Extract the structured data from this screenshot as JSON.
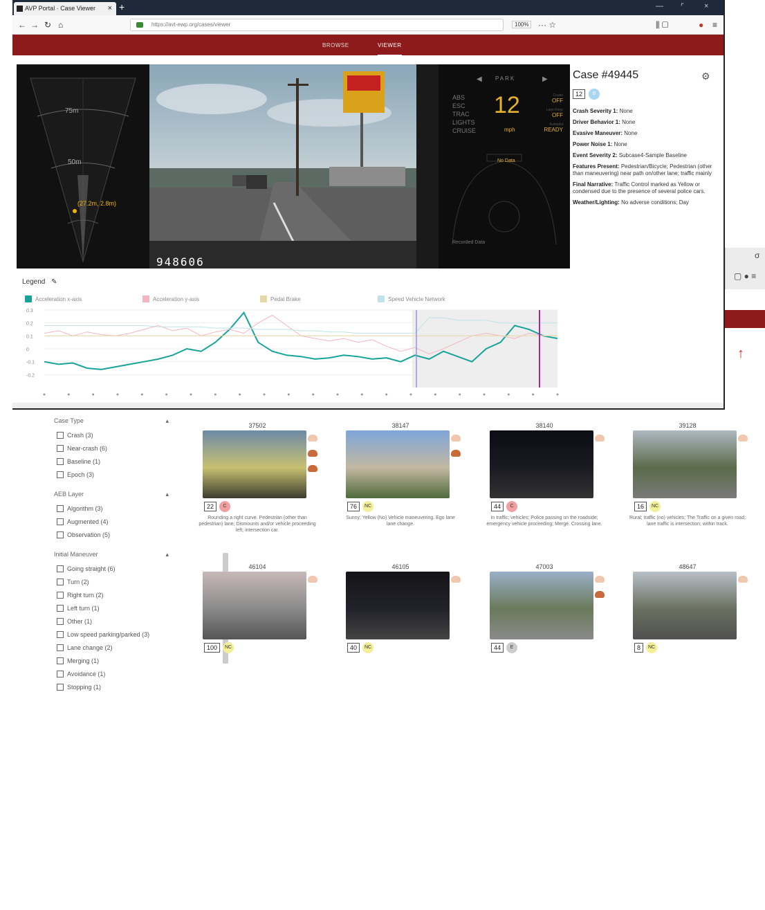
{
  "browser": {
    "tab_title": "AVP Portal · Case Viewer",
    "url": "https://avt-ewp.org/cases/viewer",
    "zoom": "100%",
    "menu_items": [
      "BROWSE",
      "VIEWER"
    ]
  },
  "dash": {
    "gear": "PARK",
    "speed": "12",
    "unit": "mph",
    "systems": [
      "ABS",
      "ESC",
      "TRAC",
      "LIGHTS",
      "CRUISE"
    ],
    "status_labels": [
      "Cruise",
      "Lane Keep",
      "Autopilot"
    ],
    "status_values": [
      "OFF",
      "OFF",
      "READY"
    ],
    "center_label": "No Data",
    "bottom_label": "Recorded Data",
    "frame_counter": "948606"
  },
  "radar": {
    "ranges": [
      "75m",
      "50m"
    ],
    "point_label": "(27.2m, 2.8m)"
  },
  "case": {
    "title": "Case #49445",
    "score": "12",
    "badge": "B",
    "lines": [
      {
        "key": "Crash Severity 1:",
        "val": "None"
      },
      {
        "key": "Driver Behavior 1:",
        "val": "None"
      },
      {
        "key": "Evasive Maneuver:",
        "val": "None"
      },
      {
        "key": "Power Noise 1:",
        "val": "None"
      },
      {
        "key": "Event Severity 2:",
        "val": "Subcase4-Sample Baseline"
      },
      {
        "key": "Features Present:",
        "val": "Pedestrian/Bicycle; Pedestrian (other than maneuvering) near path on/other lane; traffic mainly"
      },
      {
        "key": "Final Narrative:",
        "val": "Traffic Control marked as Yellow or condensed due to the presence of several police cars."
      },
      {
        "key": "Weather/Lighting:",
        "val": "No adverse conditions; Day"
      }
    ]
  },
  "chart_data": {
    "type": "line",
    "title": "",
    "legend_label": "Legend",
    "series": [
      {
        "name": "Acceleration x-axis",
        "color": "#17a398",
        "values": [
          -0.1,
          -0.12,
          -0.11,
          -0.15,
          -0.16,
          -0.14,
          -0.12,
          -0.1,
          -0.08,
          -0.05,
          0.0,
          -0.02,
          0.05,
          0.15,
          0.28,
          0.05,
          -0.02,
          -0.05,
          -0.06,
          -0.08,
          -0.07,
          -0.05,
          -0.06,
          -0.08,
          -0.07,
          -0.1,
          -0.05,
          -0.08,
          -0.02,
          -0.06,
          -0.1,
          0.0,
          0.05,
          0.18,
          0.15,
          0.1,
          0.08
        ]
      },
      {
        "name": "Acceleration y-axis",
        "color": "#f1b6bf",
        "values": [
          0.12,
          0.14,
          0.1,
          0.13,
          0.11,
          0.1,
          0.12,
          0.15,
          0.18,
          0.14,
          0.16,
          0.1,
          0.13,
          0.15,
          0.12,
          0.2,
          0.26,
          0.18,
          0.1,
          0.08,
          0.06,
          0.08,
          0.05,
          0.07,
          0.02,
          -0.02,
          0.01,
          -0.04,
          0.0,
          0.05,
          0.1,
          0.12,
          0.1,
          0.08,
          0.12,
          0.1,
          0.1
        ]
      },
      {
        "name": "Pedal Brake",
        "color": "#e8d8a8",
        "values": [
          0.1,
          0.1,
          0.1,
          0.1,
          0.1,
          0.1,
          0.1,
          0.1,
          0.1,
          0.1,
          0.1,
          0.1,
          0.1,
          0.1,
          0.1,
          0.1,
          0.1,
          0.1,
          0.1,
          0.1,
          0.1,
          0.1,
          0.1,
          0.1,
          0.1,
          0.1,
          0.1,
          0.1,
          0.1,
          0.1,
          0.1,
          0.1,
          0.1,
          0.1,
          0.1,
          0.1,
          0.1
        ]
      },
      {
        "name": "Speed Vehicle Network",
        "color": "#bfe3e8",
        "values": [
          0.18,
          0.18,
          0.18,
          0.18,
          0.18,
          0.18,
          0.18,
          0.18,
          0.17,
          0.17,
          0.17,
          0.17,
          0.16,
          0.16,
          0.16,
          0.15,
          0.15,
          0.15,
          0.14,
          0.14,
          0.13,
          0.13,
          0.12,
          0.12,
          0.12,
          0.12,
          0.12,
          0.24,
          0.24,
          0.22,
          0.22,
          0.22,
          0.2,
          0.2,
          0.2,
          0.2,
          0.2
        ]
      }
    ],
    "ylim": [
      -0.3,
      0.3
    ],
    "y_ticks": [
      "0.3",
      "0.2",
      "0.1",
      "0",
      "-0.1",
      "-0.2"
    ],
    "grid": true
  },
  "filters": {
    "groups": [
      {
        "title": "Case Type",
        "items": [
          "Crash (3)",
          "Near-crash (6)",
          "Baseline (1)",
          "Epoch (3)"
        ]
      },
      {
        "title": "AEB Layer",
        "items": [
          "Algorithm (3)",
          "Augmented (4)",
          "Observation (5)"
        ]
      },
      {
        "title": "Initial Maneuver",
        "items": [
          "Going straight (6)",
          "Turn (2)",
          "Right turn (2)",
          "Left turn (1)",
          "Other (1)",
          "Low speed parking/parked (3)",
          "Lane change (2)",
          "Merging (1)",
          "Avoidance (1)",
          "Stopping (1)"
        ]
      }
    ]
  },
  "cases": [
    {
      "id": "37502",
      "score": "22",
      "tag": "C",
      "tagcolor": "#f0a0a0",
      "desc": "Rounding a right curve. Pedestrian (other than pedestrian) lane; Dismounts and/or vehicle proceeding left; intersection car."
    },
    {
      "id": "38147",
      "score": "76",
      "tag": "NC",
      "tagcolor": "#f3ee9a",
      "desc": "Sunny; Yellow (No) Vehicle maneuvering. Ego lane lane change."
    },
    {
      "id": "38140",
      "score": "44",
      "tag": "C",
      "tagcolor": "#f0a0a0",
      "desc": "In traffic; vehicles; Police passing on the roadside; emergency vehicle proceeding; Merge. Crossing lane."
    },
    {
      "id": "39128",
      "score": "16",
      "tag": "NC",
      "tagcolor": "#f3ee9a",
      "desc": "Rural; traffic (no) vehicles; The Traffic on a given road; lane traffic is intersection; within track."
    },
    {
      "id": "46104",
      "score": "100",
      "tag": "NC",
      "tagcolor": "#f3ee9a",
      "desc": ""
    },
    {
      "id": "46105",
      "score": "40",
      "tag": "NC",
      "tagcolor": "#f3ee9a",
      "desc": ""
    },
    {
      "id": "47003",
      "score": "44",
      "tag": "E",
      "tagcolor": "#cccccc",
      "desc": ""
    },
    {
      "id": "48647",
      "score": "8",
      "tag": "NC",
      "tagcolor": "#f3ee9a",
      "desc": ""
    }
  ]
}
